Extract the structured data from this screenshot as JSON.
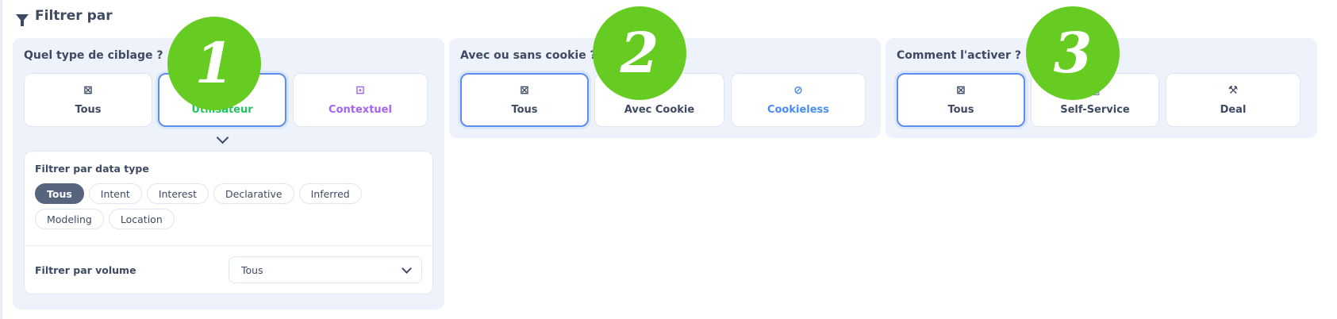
{
  "header": {
    "title": "Filtrer par"
  },
  "panels": [
    {
      "title": "Quel type de ciblage ?",
      "badge": "1",
      "options": [
        {
          "label": "Tous",
          "icon": "filter-off-icon",
          "selected": false
        },
        {
          "label": "Utilisateur",
          "icon": "user-icon",
          "selected": true
        },
        {
          "label": "Contextuel",
          "icon": "contextual-icon",
          "selected": false
        }
      ]
    },
    {
      "title": "Avec ou sans cookie ?",
      "badge": "2",
      "options": [
        {
          "label": "Tous",
          "icon": "filter-off-icon",
          "selected": true
        },
        {
          "label": "Avec Cookie",
          "icon": "cookie-icon",
          "selected": false
        },
        {
          "label": "Cookieless",
          "icon": "ban-icon",
          "selected": false
        }
      ]
    },
    {
      "title": "Comment l'activer ?",
      "badge": "3",
      "options": [
        {
          "label": "Tous",
          "icon": "filter-off-icon",
          "selected": true
        },
        {
          "label": "Self-Service",
          "icon": "self-service-icon",
          "selected": false
        },
        {
          "label": "Deal",
          "icon": "gavel-icon",
          "selected": false
        }
      ]
    }
  ],
  "data_type_filter": {
    "title": "Filtrer par data type",
    "chips": [
      "Tous",
      "Intent",
      "Interest",
      "Declarative",
      "Inferred",
      "Modeling",
      "Location"
    ],
    "active": "Tous"
  },
  "volume_filter": {
    "label": "Filtrer par volume",
    "value": "Tous"
  },
  "colors": {
    "accent_blue": "#5b8ef0",
    "badge_green": "#66cc22",
    "contextual_purple": "#a463f2",
    "cookieless_blue": "#4b8cf0",
    "user_green": "#22c55e",
    "chip_active": "#56647e"
  }
}
